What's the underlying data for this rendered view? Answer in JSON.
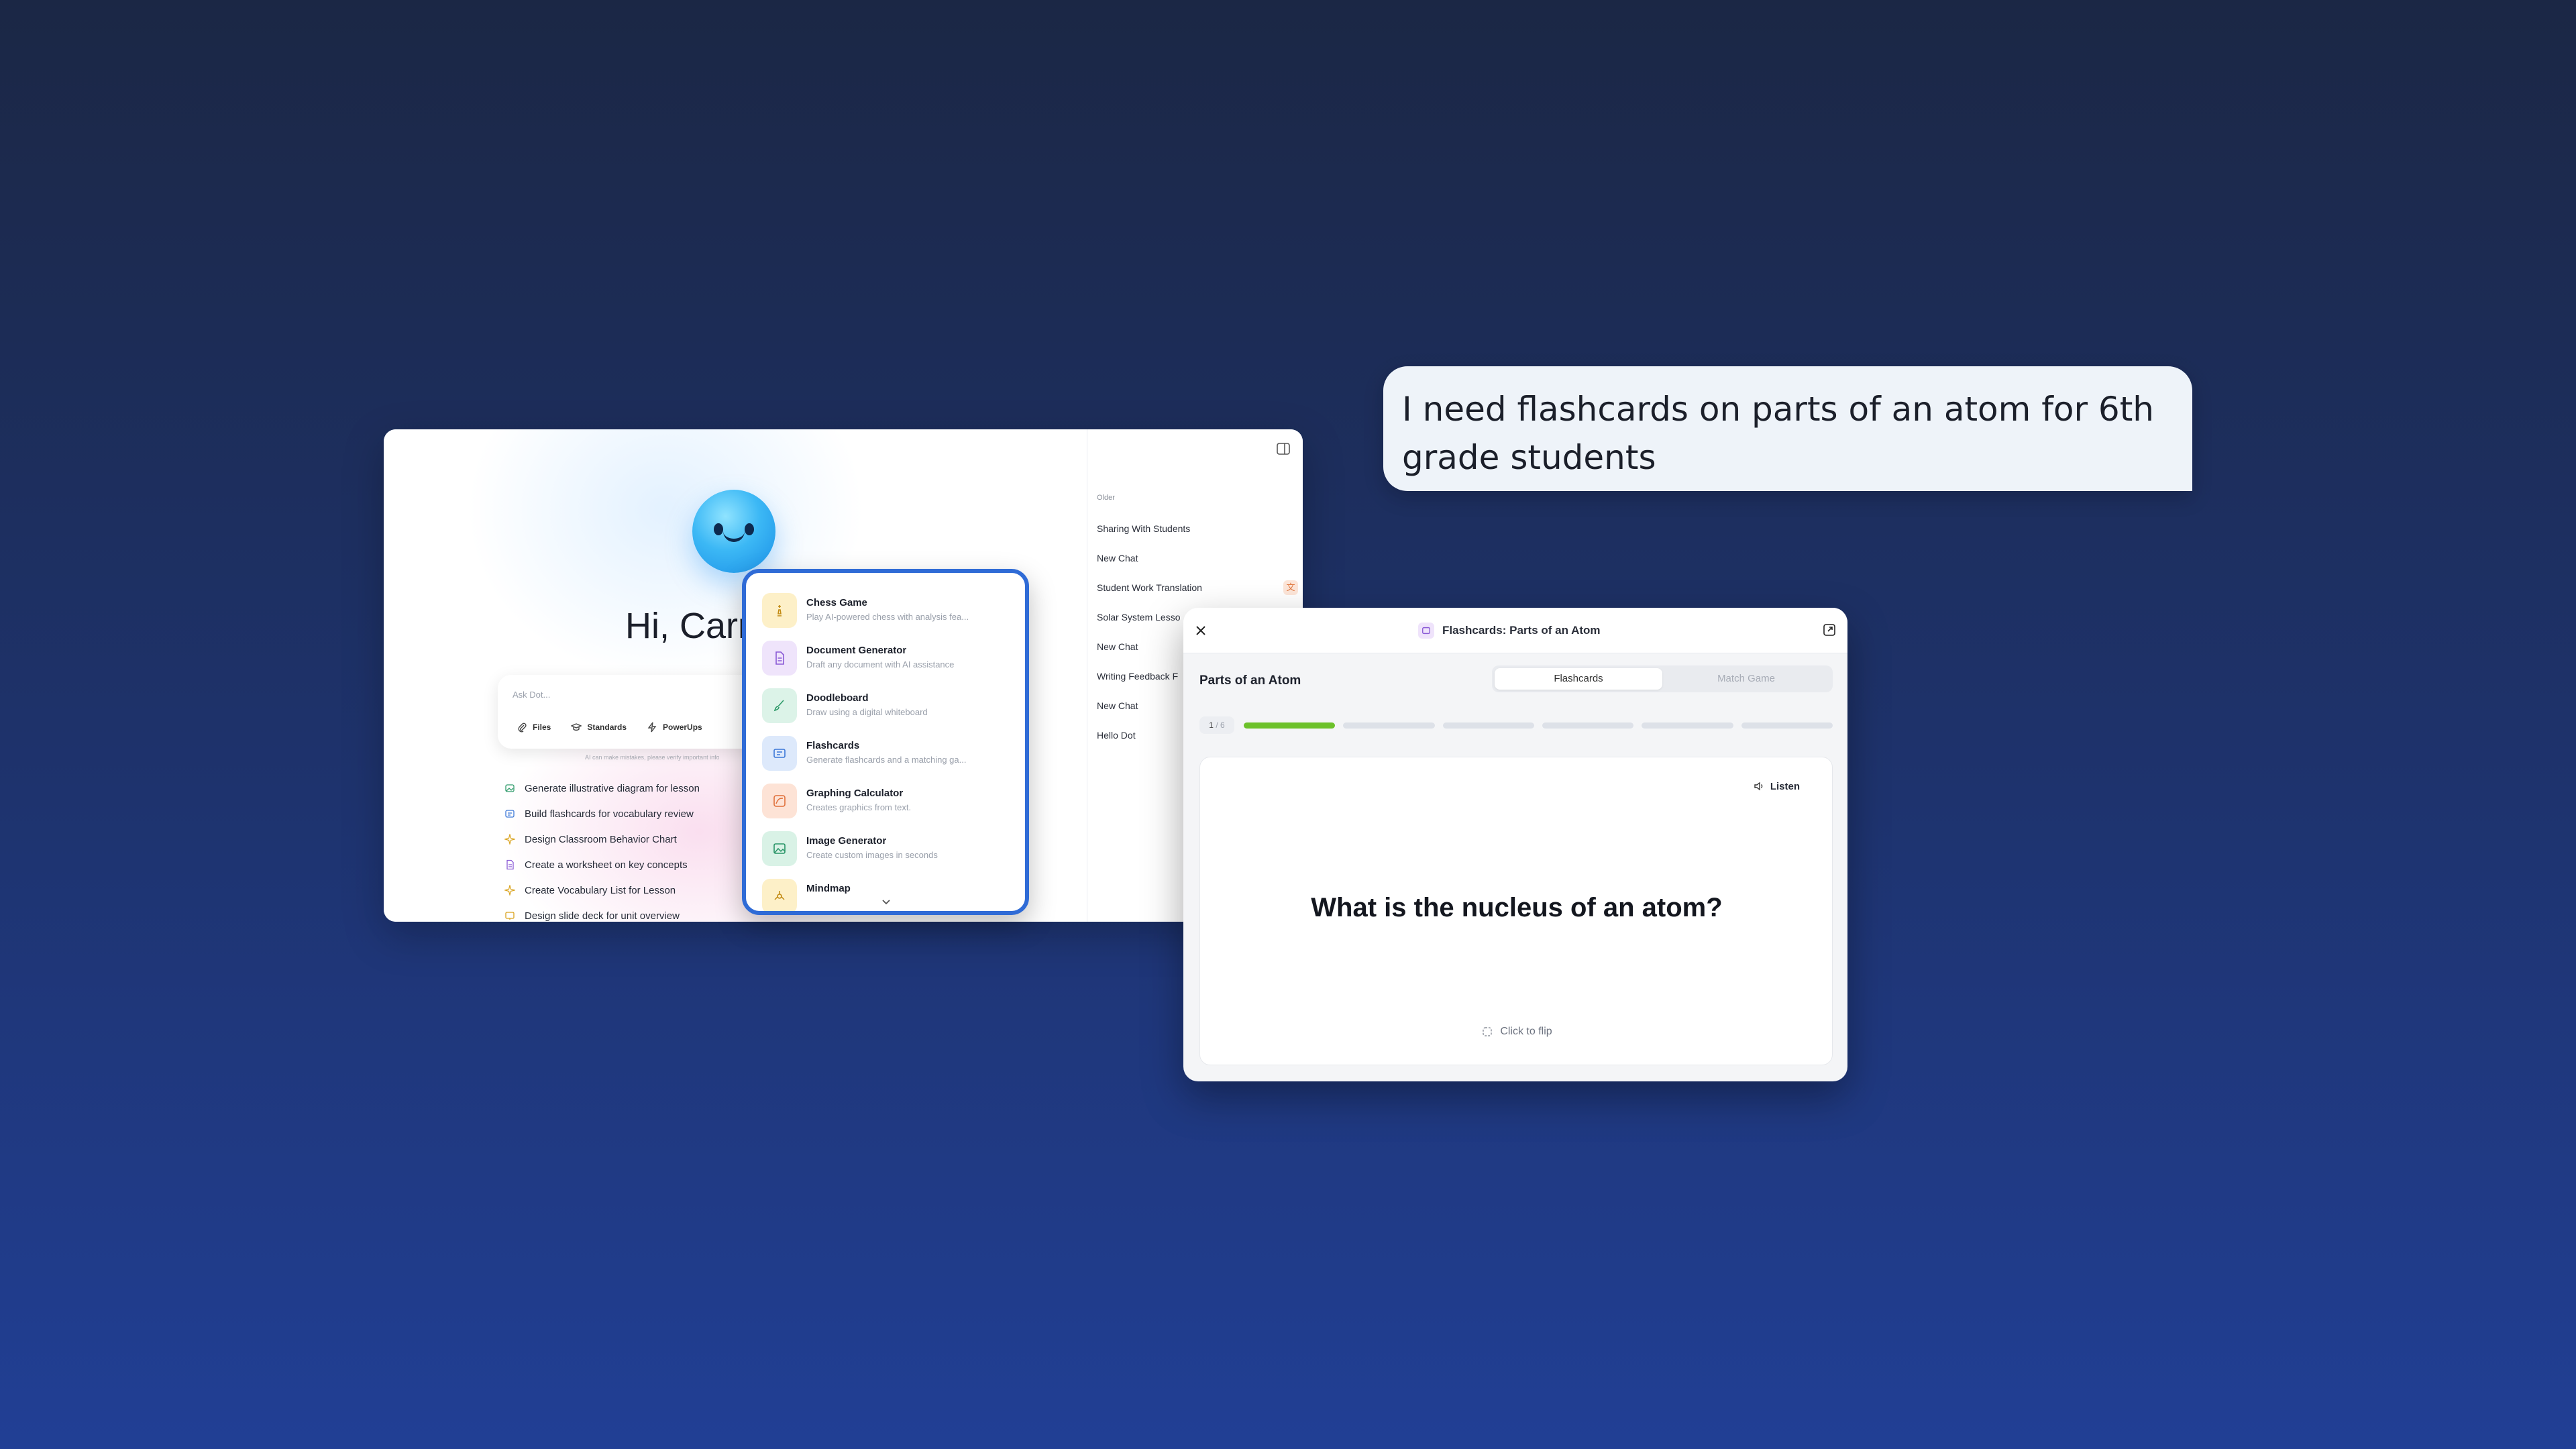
{
  "app": {
    "greeting": "Hi, Carr",
    "ask": {
      "placeholder": "Ask Dot...",
      "actions": [
        {
          "label": "Files",
          "icon": "paperclip-icon"
        },
        {
          "label": "Standards",
          "icon": "graduation-cap-icon"
        },
        {
          "label": "PowerUps",
          "icon": "lightning-icon"
        }
      ],
      "disclaimer": "AI can make mistakes, please verify important info"
    },
    "suggestions": [
      {
        "label": "Generate illustrative diagram for lesson",
        "icon": "image-icon"
      },
      {
        "label": "Build flashcards for vocabulary review",
        "icon": "flashcards-icon"
      },
      {
        "label": "Design Classroom Behavior Chart",
        "icon": "sparkle-icon"
      },
      {
        "label": "Create a worksheet on key concepts",
        "icon": "document-icon"
      },
      {
        "label": "Create Vocabulary List for Lesson",
        "icon": "sparkle-icon"
      },
      {
        "label": "Design slide deck for unit overview",
        "icon": "slides-icon"
      }
    ]
  },
  "sidebar": {
    "section_label": "Older",
    "items": [
      {
        "label": "Sharing With Students"
      },
      {
        "label": "New Chat"
      },
      {
        "label": "Student Work Translation"
      },
      {
        "label": "Solar System Lesso"
      },
      {
        "label": "New Chat"
      },
      {
        "label": "Writing Feedback F"
      },
      {
        "label": "New Chat"
      },
      {
        "label": "Hello Dot"
      }
    ]
  },
  "powerups": {
    "items": [
      {
        "title": "Chess Game",
        "desc": "Play AI-powered chess with analysis fea...",
        "icon": "chess-icon",
        "bg": "#fdf0c8",
        "fg": "#c28a12"
      },
      {
        "title": "Document Generator",
        "desc": "Draft any document with AI assistance",
        "icon": "document-icon",
        "bg": "#efe4fb",
        "fg": "#8a5ad6"
      },
      {
        "title": "Doodleboard",
        "desc": "Draw using a digital whiteboard",
        "icon": "brush-icon",
        "bg": "#dcf3e8",
        "fg": "#2f9b6a"
      },
      {
        "title": "Flashcards",
        "desc": "Generate flashcards and a matching ga...",
        "icon": "flashcards-icon",
        "bg": "#dde9fb",
        "fg": "#3c78d8"
      },
      {
        "title": "Graphing Calculator",
        "desc": "Creates graphics from text.",
        "icon": "graph-icon",
        "bg": "#fde3d6",
        "fg": "#e0703a"
      },
      {
        "title": "Image Generator",
        "desc": "Create custom images in seconds",
        "icon": "image-icon",
        "bg": "#d9f2e6",
        "fg": "#279466"
      },
      {
        "title": "Mindmap",
        "desc": "",
        "icon": "mindmap-icon",
        "bg": "#fdf0c8",
        "fg": "#c28a12"
      }
    ]
  },
  "chat": {
    "message": "I need flashcards on parts of an atom for 6th grade students"
  },
  "flashcards": {
    "window_title": "Flashcards: Parts of an Atom",
    "subject": "Parts of an Atom",
    "tabs": [
      {
        "label": "Flashcards",
        "active": true
      },
      {
        "label": "Match Game",
        "active": false
      }
    ],
    "progress": {
      "current": "1",
      "total": "6",
      "separator": "/"
    },
    "listen_label": "Listen",
    "question": "What is the nucleus of an atom?",
    "flip_label": "Click to flip"
  }
}
